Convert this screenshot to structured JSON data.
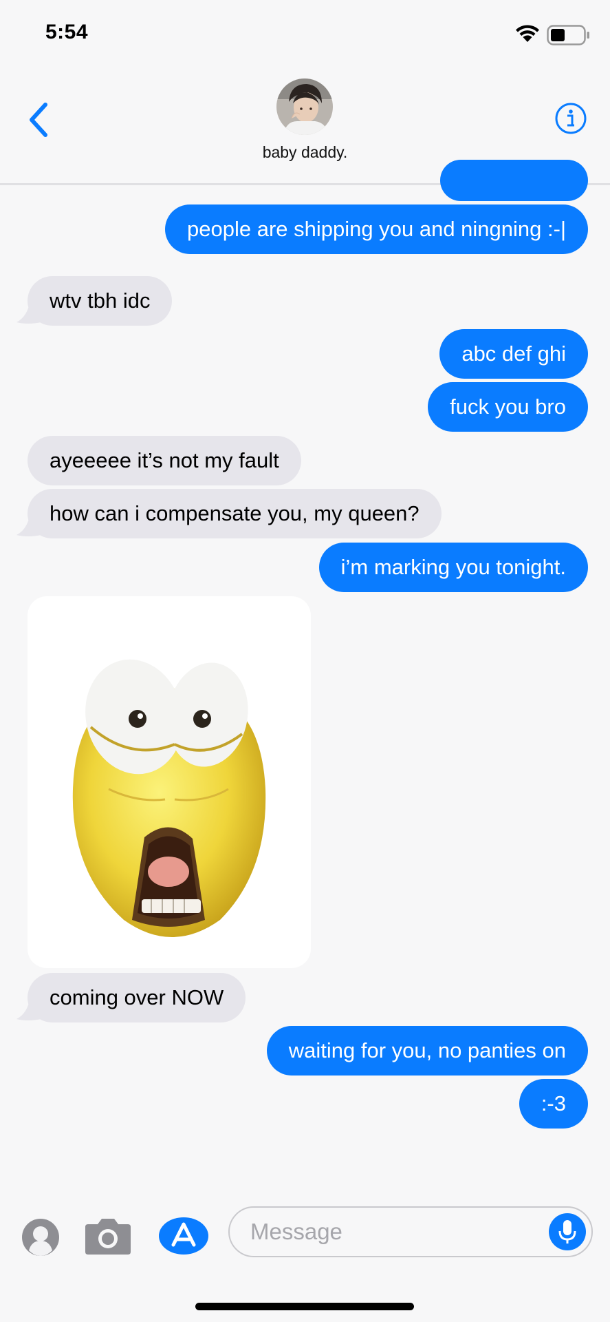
{
  "status_bar": {
    "time": "5:54",
    "wifi_icon": "wifi-icon",
    "battery_icon": "battery-icon"
  },
  "header": {
    "back_icon": "chevron-left-icon",
    "contact_name": "baby daddy.",
    "info_icon": "info-icon",
    "accent_color": "#0a7cff"
  },
  "messages": [
    {
      "direction": "outgoing",
      "text": "people are shipping you and ningning :-|"
    },
    {
      "direction": "incoming",
      "text": "wtv tbh idc"
    },
    {
      "direction": "outgoing",
      "text": "abc def ghi"
    },
    {
      "direction": "outgoing",
      "text": "fuck you bro"
    },
    {
      "direction": "incoming",
      "text": "ayeeeee it’s not my fault"
    },
    {
      "direction": "incoming",
      "text": "how can i compensate you, my queen?"
    },
    {
      "direction": "outgoing",
      "text": "i’m marking you tonight."
    },
    {
      "direction": "incoming",
      "type": "sticker",
      "icon": "shocked-emoji-sticker"
    },
    {
      "direction": "incoming",
      "text": "coming over NOW"
    },
    {
      "direction": "outgoing",
      "text": "waiting for you, no panties on"
    },
    {
      "direction": "outgoing",
      "text": ":-3"
    }
  ],
  "composer": {
    "placeholder": "Message",
    "icons": [
      "contacts-icon",
      "camera-icon",
      "app-store-icon",
      "microphone-icon"
    ]
  },
  "colors": {
    "outgoing_bubble": "#0a7cff",
    "incoming_bubble": "#e6e5eb",
    "background": "#f7f7f8"
  }
}
